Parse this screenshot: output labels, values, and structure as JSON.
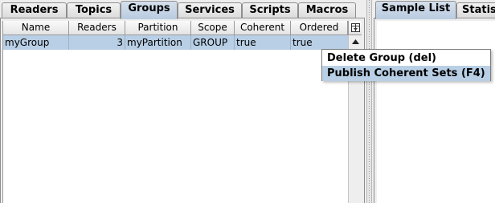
{
  "left_tabs": [
    {
      "label": "Readers"
    },
    {
      "label": "Topics"
    },
    {
      "label": "Groups",
      "selected": true
    },
    {
      "label": "Services"
    },
    {
      "label": "Scripts"
    },
    {
      "label": "Macros"
    }
  ],
  "table": {
    "columns": [
      "Name",
      "Readers",
      "Partition",
      "Scope",
      "Coherent",
      "Ordered"
    ],
    "rows": [
      [
        "myGroup",
        "3",
        "myPartition",
        "GROUP",
        "true",
        "true"
      ]
    ]
  },
  "right_tabs": [
    {
      "label": "Sample List",
      "selected": true
    },
    {
      "label": "Statis"
    }
  ],
  "context_menu": {
    "items": [
      {
        "label": "Delete Group (del)"
      },
      {
        "label": "Publish Coherent Sets (F4)",
        "highlighted": true
      }
    ]
  },
  "icons": {
    "corner": "column-chooser-icon",
    "scroll_up": "arrow-up-icon"
  },
  "colors": {
    "selection": "#b8cfe5",
    "selected_tab": "#c4d3e6"
  }
}
